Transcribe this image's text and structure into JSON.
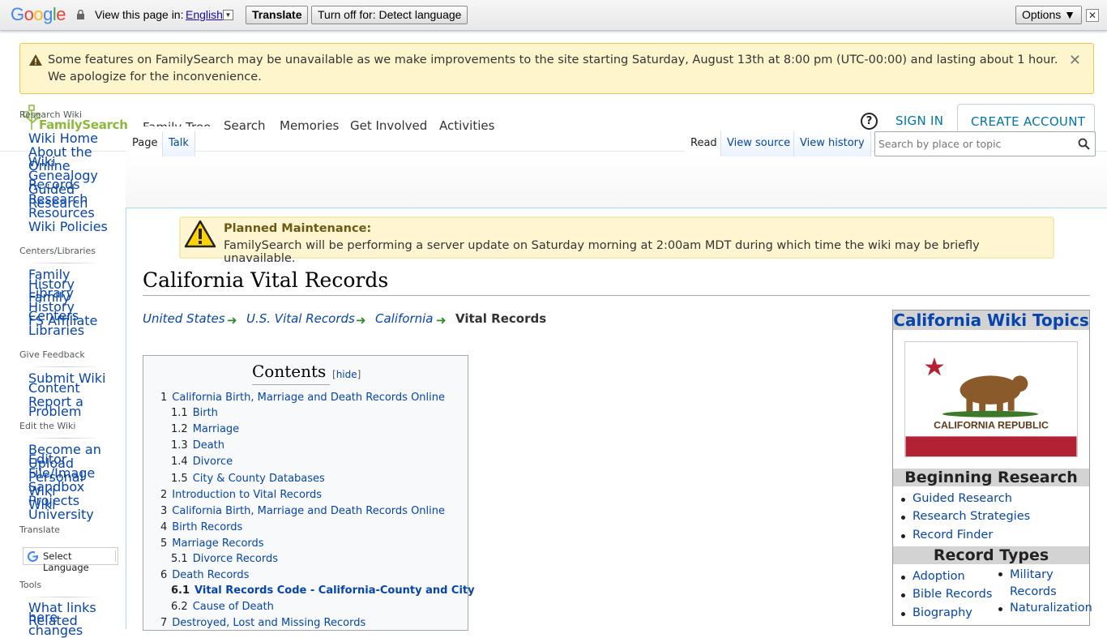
{
  "google_bar": {
    "logo": "Google",
    "view_label": "View this page in:",
    "language": "English",
    "translate_btn": "Translate",
    "turn_off_btn": "Turn off for: Detect language",
    "options_btn": "Options ▼",
    "close": "✕"
  },
  "alert": {
    "text": "Some features on FamilySearch may be unavailable as we make improvements to the site starting Saturday, August 13th at 8:00 pm (UTC-00:00) and lasting about 1 hour. We apologize for the inconvenience.",
    "close": "✕"
  },
  "header": {
    "logo_text": "FamilySearch",
    "nav": [
      "Family Tree",
      "Search",
      "Memories",
      "Get Involved",
      "Activities"
    ],
    "help": "?",
    "sign_in": "SIGN IN",
    "create_account": "CREATE ACCOUNT"
  },
  "wiki_tabs": {
    "page": "Page",
    "talk": "Talk",
    "read": "Read",
    "view_source": "View source",
    "view_history": "View history",
    "search_placeholder": "Search by place or topic"
  },
  "sidebar": {
    "research_wiki": "Research Wiki",
    "main_links": [
      "Wiki Home",
      "About the Wiki",
      "Online Genealogy Records",
      "Guided Research",
      "Research Resources",
      "Wiki Policies"
    ],
    "centers_heading": "Centers/Libraries",
    "centers_links": [
      "Family History Library",
      "Family History Centers",
      "FS Affiliate Libraries"
    ],
    "feedback_heading": "Give Feedback",
    "feedback_links": [
      "Submit Wiki Content",
      "Report a Problem"
    ],
    "edit_heading": "Edit the Wiki",
    "edit_links": [
      "Become an Editor",
      "Upload File/Image",
      "Personal Sandbox",
      "Wiki Projects",
      "Wiki University"
    ],
    "translate_heading": "Translate",
    "select_language": "Select Language",
    "tools_heading": "Tools",
    "tools_links": [
      "What links here",
      "Related changes"
    ]
  },
  "planned": {
    "title": "Planned Maintenance:",
    "text": "FamilySearch will be performing a server update on Saturday morning at 2:00am MDT during which time the wiki may be briefly unavailable."
  },
  "page": {
    "title": "California Vital Records",
    "breadcrumbs": [
      "United States",
      "U.S. Vital Records",
      "California"
    ],
    "current": "Vital Records"
  },
  "toc": {
    "title": "Contents",
    "hide": "hide",
    "items": [
      {
        "num": "1",
        "text": "California Birth, Marriage and Death Records Online"
      },
      {
        "num": "1.1",
        "text": "Birth"
      },
      {
        "num": "1.2",
        "text": "Marriage"
      },
      {
        "num": "1.3",
        "text": "Death"
      },
      {
        "num": "1.4",
        "text": "Divorce"
      },
      {
        "num": "1.5",
        "text": "City & County Databases"
      },
      {
        "num": "2",
        "text": "Introduction to Vital Records"
      },
      {
        "num": "3",
        "text": "California Birth, Marriage and Death Records Online"
      },
      {
        "num": "4",
        "text": "Birth Records"
      },
      {
        "num": "5",
        "text": "Marriage Records"
      },
      {
        "num": "5.1",
        "text": "Divorce Records"
      },
      {
        "num": "6",
        "text": "Death Records"
      },
      {
        "num": "6.1",
        "text": "Vital Records Code - California-County and City"
      },
      {
        "num": "6.2",
        "text": "Cause of Death"
      },
      {
        "num": "7",
        "text": "Destroyed, Lost and Missing Records"
      }
    ]
  },
  "infobox": {
    "title": "California Wiki Topics",
    "flag_caption": "CALIFORNIA REPUBLIC",
    "beginning_heading": "Beginning Research",
    "beginning_links": [
      "Guided Research",
      "Research Strategies",
      "Record Finder"
    ],
    "record_types_heading": "Record Types",
    "record_col1": [
      "Adoption",
      "Bible Records",
      "Biography"
    ],
    "record_col2": [
      "Military Records",
      "Naturalization"
    ],
    "colors": {
      "flag_red": "#b22234",
      "bear_brown": "#8b5a2b",
      "grass": "#3c7a2a"
    }
  }
}
